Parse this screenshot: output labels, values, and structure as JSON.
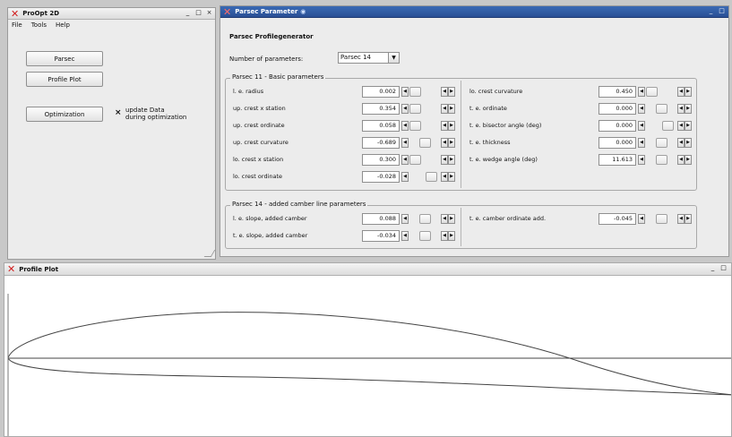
{
  "main_window": {
    "title": "ProOpt 2D",
    "controls": [
      "_",
      "□",
      "×"
    ],
    "menu": [
      "File",
      "Tools",
      "Help"
    ],
    "buttons": {
      "parsec": "Parsec",
      "profile_plot": "Profile Plot",
      "optimization": "Optimization"
    },
    "checkbox": {
      "mark": "×",
      "label_line1": "update Data",
      "label_line2": "during optimization",
      "checked": true
    }
  },
  "parsec_window": {
    "title": "Parsec Parameter",
    "controls": [
      "_",
      "□"
    ],
    "heading": "Parsec Profilegenerator",
    "num_params_label": "Number of parameters:",
    "num_params_value": "Parsec 14",
    "basic": {
      "title": "Parsec 11 - Basic parameters",
      "left": [
        {
          "label": "l. e. radius",
          "value": "0.002"
        },
        {
          "label": "up. crest x station",
          "value": "0.354"
        },
        {
          "label": "up. crest ordinate",
          "value": "0.058"
        },
        {
          "label": "up. crest curvature",
          "value": "-0.689"
        },
        {
          "label": "lo. crest x station",
          "value": "0.300"
        },
        {
          "label": "lo. crest ordinate",
          "value": "-0.028"
        }
      ],
      "right": [
        {
          "label": "lo. crest curvature",
          "value": "0.450"
        },
        {
          "label": "t. e. ordinate",
          "value": "0.000"
        },
        {
          "label": "t. e. bisector angle (deg)",
          "value": "0.000"
        },
        {
          "label": "t. e. thickness",
          "value": "0.000"
        },
        {
          "label": "t. e. wedge angle (deg)",
          "value": "11.613"
        }
      ],
      "left_slider_pos": [
        0.0,
        0.0,
        0.0,
        0.5,
        0.0,
        0.8
      ],
      "right_slider_pos": [
        0.0,
        0.5,
        0.8,
        0.5,
        0.5
      ]
    },
    "camber": {
      "title": "Parsec 14 - added camber line parameters",
      "left": [
        {
          "label": "l. e. slope, added camber",
          "value": "0.088"
        },
        {
          "label": "t. e. slope, added camber",
          "value": "-0.034"
        }
      ],
      "right": [
        {
          "label": "t. e. camber ordinate add.",
          "value": "-0.045"
        }
      ],
      "left_slider_pos": [
        0.5,
        0.5
      ],
      "right_slider_pos": [
        0.5
      ]
    }
  },
  "profile_window": {
    "title": "Profile Plot",
    "controls": [
      "_",
      "□"
    ]
  }
}
